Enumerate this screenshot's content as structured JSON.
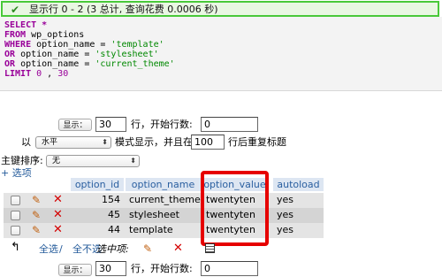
{
  "banner": {
    "check_icon": "check-icon",
    "message": "显示行 0 - 2 (3 总计, 查询花费 0.0006 秒)"
  },
  "sql": {
    "line1": "SELECT *",
    "line2_kw": "FROM",
    "line2_rest": " wp_options",
    "line3_kw": "WHERE",
    "line3_mid": " option_name = ",
    "line3_str": "'template'",
    "line4_kw": "OR",
    "line4_mid": " option_name = ",
    "line4_str": "'stylesheet'",
    "line5_kw": "OR",
    "line5_mid": " option_name = ",
    "line5_str": "'current_theme'",
    "line6_kw": "LIMIT",
    "line6_a": " 0 ",
    "line6_comma": ",",
    "line6_b": " 30"
  },
  "nav": {
    "show_button": "显示：",
    "rows_value": "30",
    "rows_label": "行，开始行数:",
    "start_value": "0",
    "with_label": "以",
    "mode_value": "水平",
    "mode_label": "模式显示，并且在",
    "repeat_value": "100",
    "repeat_label": "行后重复标题"
  },
  "sort": {
    "label": "主键排序:",
    "value": "无"
  },
  "options_link": "+ 选项",
  "table": {
    "columns": [
      "option_id",
      "option_name",
      "option_value",
      "autoload"
    ],
    "rows": [
      {
        "option_id": "154",
        "option_name": "current_theme",
        "option_value": "twentyten",
        "autoload": "yes"
      },
      {
        "option_id": "45",
        "option_name": "stylesheet",
        "option_value": "twentyten",
        "autoload": "yes"
      },
      {
        "option_id": "44",
        "option_name": "template",
        "option_value": "twentyten",
        "autoload": "yes"
      }
    ]
  },
  "bulk": {
    "select_all": "全选",
    "separator": " / ",
    "deselect_all": "全不选",
    "selected_label": "选中项:"
  },
  "nav_bottom": {
    "show_button": "显示：",
    "rows_value": "30",
    "rows_label": "行，开始行数:",
    "start_value": "0"
  },
  "colors": {
    "banner_border": "#49c93a",
    "highlight": "#e60000",
    "header_bg": "#dde6f2",
    "row_odd": "#e4e4e4",
    "row_even": "#d4d4d4"
  }
}
